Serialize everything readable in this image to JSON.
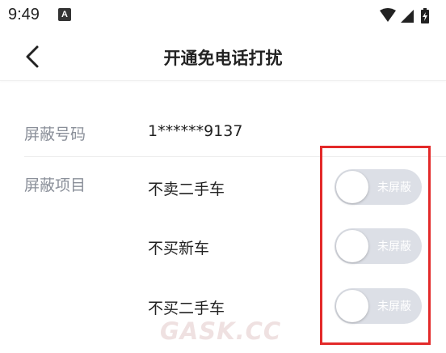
{
  "status_bar": {
    "time": "9:49",
    "notification_icon": "A",
    "wifi_icon": "wifi-icon",
    "signal_icon": "signal-icon",
    "battery_icon": "battery-icon"
  },
  "header": {
    "title": "开通免电话打扰",
    "back_icon": "chevron-left-icon"
  },
  "blocked_number": {
    "label": "屏蔽号码",
    "value": "1******9137"
  },
  "block_items": {
    "label": "屏蔽项目",
    "items": [
      {
        "label": "不卖二手车",
        "toggle_text": "未屏蔽",
        "enabled": false
      },
      {
        "label": "不买新车",
        "toggle_text": "未屏蔽",
        "enabled": false
      },
      {
        "label": "不买二手车",
        "toggle_text": "未屏蔽",
        "enabled": false
      }
    ]
  },
  "colors": {
    "highlight": "#e32a2a",
    "toggle_off": "#dcdfe6",
    "label_gray": "#8a8f99"
  },
  "watermark": "GASK.CC"
}
